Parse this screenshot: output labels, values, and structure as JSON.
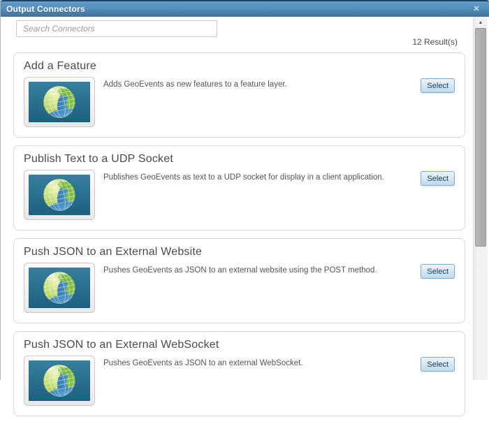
{
  "window": {
    "title": "Output Connectors"
  },
  "icons": {
    "close": "✕",
    "scroll_up": "▲"
  },
  "search": {
    "placeholder": "Search Connectors",
    "value": ""
  },
  "results_count": "12 Result(s)",
  "cards": [
    {
      "title": "Add a Feature",
      "description": "Adds GeoEvents as new features to a feature layer.",
      "select_label": "Select"
    },
    {
      "title": "Publish Text to a UDP Socket",
      "description": "Publishes GeoEvents as text to a UDP socket for display in a client application.",
      "select_label": "Select"
    },
    {
      "title": "Push JSON to an External Website",
      "description": "Pushes GeoEvents as JSON to an external website using the POST method.",
      "select_label": "Select"
    },
    {
      "title": "Push JSON to an External WebSocket",
      "description": "Pushes GeoEvents as JSON to an external WebSocket.",
      "select_label": "Select"
    }
  ],
  "colors": {
    "titlebar_top": "#1c4466",
    "titlebar_gradient_start": "#669dc6",
    "titlebar_gradient_end": "#3f719c",
    "titlebar_text": "#ffffff",
    "card_border": "#d8d8d8",
    "card_title_text": "#4a4a4a",
    "description_text": "#555555",
    "button_border": "#7fa9cf",
    "button_bg_start": "#ecf4fb",
    "button_bg_end": "#c0d9ee",
    "button_text": "#17395a",
    "globe_bg": "#2b7292",
    "scroll_thumb": "#a9a9a9"
  }
}
